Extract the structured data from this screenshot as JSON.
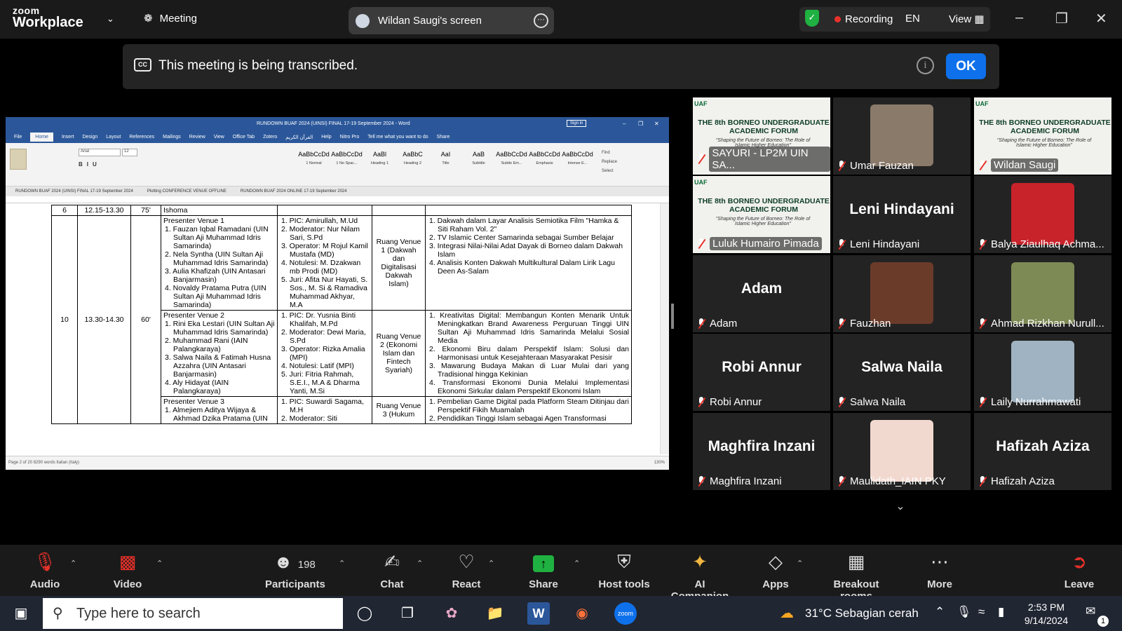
{
  "topbar": {
    "logo_line1": "zoom",
    "logo_line2": "Workplace",
    "meeting_label": "Meeting",
    "screen_label": "Wildan Saugi's screen",
    "recording": "Recording",
    "language": "EN",
    "view": "View"
  },
  "banner": {
    "cc": "CC",
    "text": "This meeting is being transcribed.",
    "info": "i",
    "ok": "OK"
  },
  "word": {
    "title": "RUNDOWN BUAF 2024 (UINSI) FINAL 17-19 September 2024  -  Word",
    "sign_in": "Sign in",
    "tabs": [
      "File",
      "Home",
      "Insert",
      "Design",
      "Layout",
      "References",
      "Mailings",
      "Review",
      "View",
      "Office Tab",
      "Zotero",
      "القرآن الكريم",
      "Help",
      "Nitro Pro",
      "Tell me what you want to do",
      "Share"
    ],
    "styles": [
      {
        "preview": "AaBbCcDd",
        "name": "1 Normal"
      },
      {
        "preview": "AaBbCcDd",
        "name": "1 No Spac..."
      },
      {
        "preview": "AaBl",
        "name": "Heading 1"
      },
      {
        "preview": "AaBbC",
        "name": "Heading 2"
      },
      {
        "preview": "AaI",
        "name": "Title"
      },
      {
        "preview": "AaB",
        "name": "Subtitle"
      },
      {
        "preview": "AaBbCcDd",
        "name": "Subtle Em..."
      },
      {
        "preview": "AaBbCcDd",
        "name": "Emphasis"
      },
      {
        "preview": "AaBbCcDd",
        "name": "Intense E..."
      }
    ],
    "find": "Find",
    "replace": "Replace",
    "select": "Select",
    "font": "Arial",
    "size": "12",
    "doc_tabs": [
      "RUNDOWN BUAF 2024 (UINSI) FINAL 17-19 September 2024",
      "Plotting CONFERENCE VENUE OFFLINE",
      "RUNDOWN BUAF 2024 ONLINE 17-19 September 2024"
    ],
    "status": "Page 2 of 20    8290 words    Italian (Italy)",
    "zoom": "130%",
    "table": {
      "row6": {
        "no": "6",
        "time": "12.15-13.30",
        "dur": "75'",
        "act": "Ishoma"
      },
      "row10": {
        "no": "10",
        "time": "13.30-14.30",
        "dur": "60'"
      },
      "v1": {
        "title": "Presenter Venue 1",
        "presenters": [
          "1.  Fauzan Iqbal Ramadani (UIN Sultan Aji Muhammad Idris Samarinda)",
          "2.  Nela Syntha (UIN Sultan Aji Muhammad Idris Samarinda)",
          "3.  Aulia Khafizah (UIN Antasari Banjarmasin)",
          "4.  Novaldy Pratama Putra (UIN Sultan Aji Muhammad Idris Samarinda)"
        ],
        "staff": [
          "1. PIC: Amirullah, M.Ud",
          "2. Moderator: Nur Nilam Sari, S.Pd",
          "3. Operator: M Rojul Kamil Mustafa (MD)",
          "4. Notulesi: M. Dzakwan mb Prodi (MD)",
          "5. Juri: Afita Nur Hayati, S. Sos., M. Si & Ramadiva Muhammad Akhyar, M.A"
        ],
        "room": "Ruang Venue 1 (Dakwah dan Digitalisasi Dakwah Islam)",
        "topics": [
          "1. Dakwah dalam Layar Analisis Semiotika Film \"Hamka & Siti Raham Vol. 2\"",
          "2. TV Islamic Center Samarinda sebagai Sumber Belajar",
          "3. Integrasi Nilai-Nilai Adat Dayak di Borneo dalam Dakwah Islam",
          "4. Analisis Konten Dakwah Multikultural Dalam Lirik Lagu Deen As-Salam"
        ]
      },
      "v2": {
        "title": "Presenter Venue 2",
        "presenters": [
          "1.  Rini Eka Lestari (UIN Sultan Aji Muhammad Idris Samarinda)",
          "2.  Muhammad Rani (IAIN Palangkaraya)",
          "3.  Salwa Naila & Fatimah Husna Azzahra (UIN Antasari Banjarmasin)",
          "4.  Aly Hidayat (IAIN Palangkaraya)"
        ],
        "staff": [
          "1. PIC: Dr. Yusnia Binti Khalifah, M.Pd",
          "2. Moderator: Dewi Maria, S.Pd",
          "3. Operator: Rizka Amalia (MPI)",
          "4. Notulesi: Latif (MPI)",
          "5. Juri: Fitria Rahmah, S.E.I., M.A & Dharma Yanti, M.Si"
        ],
        "room": "Ruang Venue 2 (Ekonomi Islam dan Fintech Syariah)",
        "topics": [
          "1. Kreativitas Digital: Membangun Konten Menarik Untuk Meningkatkan Brand Awareness Perguruan Tinggi UIN Sultan Aji Muhammad Idris Samarinda Melalui Sosial Media",
          "2. Ekonomi Biru dalam Perspektif Islam: Solusi dan Harmonisasi untuk Kesejahteraan Masyarakat Pesisir",
          "3. Mawarung Budaya Makan di Luar Mulai dari yang Tradisional hingga Kekinian",
          "4. Transformasi Ekonomi Dunia Melalui Implementasi Ekonomi Sirkular dalam Perspektif Ekonomi Islam"
        ]
      },
      "v3": {
        "title": "Presenter Venue 3",
        "presenters": [
          "1.  Almejiem Aditya Wijaya & Akhmad Dzika Pratama (UIN"
        ],
        "staff": [
          "1. PIC: Suwardi Sagama, M.H",
          "2. Moderator: Siti"
        ],
        "room": "Ruang Venue 3 (Hukum",
        "topics": [
          "1. Pembelian Game Digital pada Platform Steam Ditinjau dari Perspektif Fikih Muamalah",
          "2. Pendidikan Tinggi Islam sebagai Agen Transformasi"
        ]
      }
    }
  },
  "gallery": {
    "forum_title": "THE 8th BORNEO UNDERGRADUATE ACADEMIC FORUM",
    "forum_sub": "\"Shaping the Future of Borneo: The Role of Islamic Higher Education\"",
    "forum_logo": "UAF",
    "tiles": [
      {
        "name": "SAYURI - LP2M UIN SA...",
        "type": "banner"
      },
      {
        "name": "Umar Fauzan",
        "type": "photo",
        "color": "#8a7a6a"
      },
      {
        "name": "Wildan Saugi",
        "type": "banner"
      },
      {
        "name": "Luluk Humairo Pimada",
        "type": "banner"
      },
      {
        "name": "Leni Hindayani",
        "type": "text",
        "big": "Leni Hindayani"
      },
      {
        "name": "Balya Ziaulhaq Achma...",
        "type": "photo",
        "color": "#c8232b"
      },
      {
        "name": "Adam",
        "type": "text",
        "big": "Adam"
      },
      {
        "name": "Fauzhan",
        "type": "photo",
        "color": "#6b3b2a"
      },
      {
        "name": "Ahmad Rizkhan Nurull...",
        "type": "photo",
        "color": "#7d8a55"
      },
      {
        "name": "Robi Annur",
        "type": "text",
        "big": "Robi Annur"
      },
      {
        "name": "Salwa Naila",
        "type": "text",
        "big": "Salwa Naila"
      },
      {
        "name": "Laily Nurrahmawati",
        "type": "photo",
        "color": "#9fb3c2"
      },
      {
        "name": "Maghfira Inzani",
        "type": "text",
        "big": "Maghfira Inzani"
      },
      {
        "name": "Maulidath_IAIN PKY",
        "type": "photo",
        "color": "#f2d9cf"
      },
      {
        "name": "Hafizah Aziza",
        "type": "text",
        "big": "Hafizah Aziza"
      }
    ]
  },
  "toolbar": {
    "audio": "Audio",
    "video": "Video",
    "participants": "Participants",
    "participants_count": "198",
    "chat": "Chat",
    "react": "React",
    "share": "Share",
    "host_tools": "Host tools",
    "ai_companion": "AI Companion",
    "apps": "Apps",
    "breakout": "Breakout rooms",
    "more": "More",
    "leave": "Leave"
  },
  "taskbar": {
    "search_placeholder": "Type here to search",
    "weather": "31°C  Sebagian cerah",
    "time": "2:53 PM",
    "date": "9/14/2024",
    "notif": "1"
  },
  "colors": {
    "accent": "#0e71eb",
    "share_green": "#1fb141",
    "active_speaker": "#1ec24a",
    "leave_red": "#e8312a"
  }
}
